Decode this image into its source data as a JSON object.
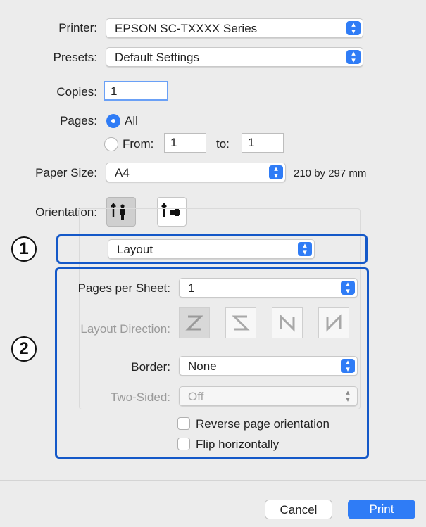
{
  "printer": {
    "label": "Printer:",
    "value": "EPSON SC-TXXXX Series"
  },
  "presets": {
    "label": "Presets:",
    "value": "Default Settings"
  },
  "copies": {
    "label": "Copies:",
    "value": "1"
  },
  "pages": {
    "label": "Pages:",
    "all_label": "All",
    "from_label": "From:",
    "from_value": "1",
    "to_label": "to:",
    "to_value": "1"
  },
  "paper": {
    "label": "Paper Size:",
    "value": "A4",
    "dimensions": "210 by 297 mm"
  },
  "orientation": {
    "label": "Orientation:",
    "options": [
      "portrait-icon",
      "landscape-icon"
    ]
  },
  "panel": {
    "value": "Layout"
  },
  "layout": {
    "pages_per_sheet_label": "Pages per Sheet:",
    "pages_per_sheet_value": "1",
    "direction_label": "Layout Direction:",
    "border_label": "Border:",
    "border_value": "None",
    "two_sided_label": "Two-Sided:",
    "two_sided_value": "Off",
    "reverse_label": "Reverse page orientation",
    "flip_label": "Flip horizontally"
  },
  "callouts": {
    "one": "1",
    "two": "2",
    "accent": "#1458c8"
  },
  "buttons": {
    "cancel": "Cancel",
    "print": "Print"
  },
  "colors": {
    "accent": "#2f7cf6",
    "background": "#ececec"
  }
}
